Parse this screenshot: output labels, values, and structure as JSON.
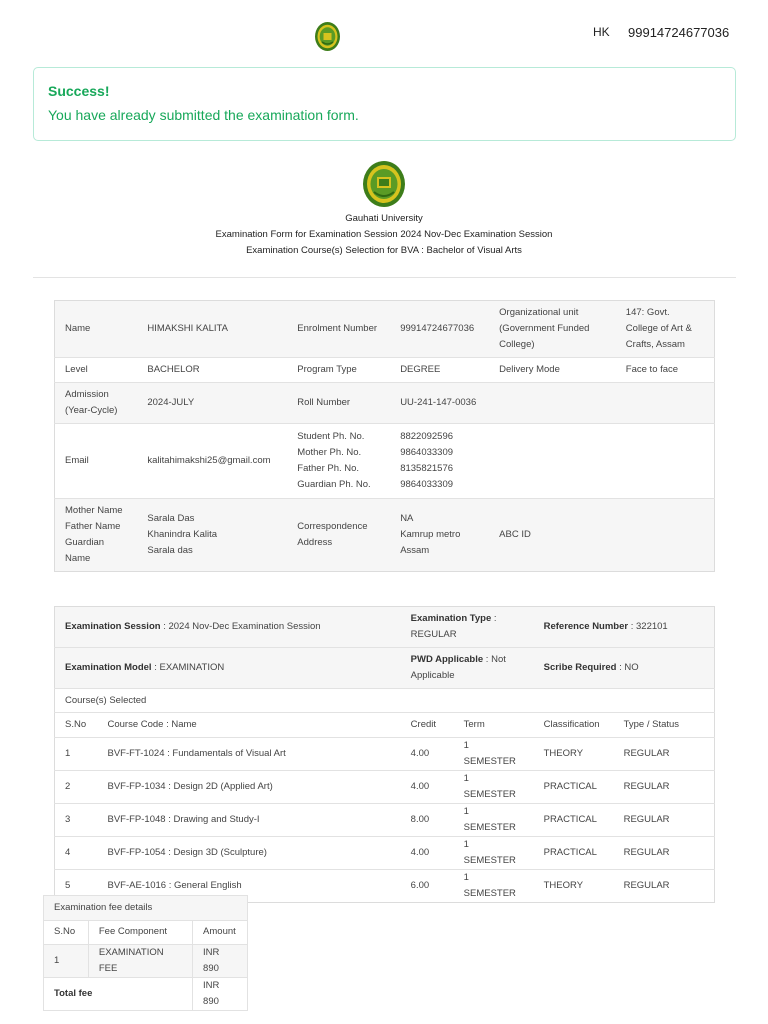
{
  "topbar": {
    "user_initials": "HK",
    "user_id": "99914724677036"
  },
  "alert": {
    "title": "Success!",
    "message": "You have already submitted the examination form."
  },
  "header": {
    "university": "Gauhati University",
    "form_title": "Examination Form for Examination Session 2024 Nov-Dec Examination Session",
    "course_selection": "Examination Course(s) Selection for BVA : Bachelor of Visual Arts"
  },
  "student": {
    "name_label": "Name",
    "name": "HIMAKSHI KALITA",
    "enrolment_label": "Enrolment Number",
    "enrolment": "99914724677036",
    "org_unit_label": "Organizational unit (Government Funded College)",
    "org_unit": "147: Govt. College of Art & Crafts, Assam",
    "level_label": "Level",
    "level": "BACHELOR",
    "program_type_label": "Program Type",
    "program_type": "DEGREE",
    "delivery_mode_label": "Delivery Mode",
    "delivery_mode": "Face to face",
    "admission_label": "Admission (Year-Cycle)",
    "admission": "2024-JULY",
    "roll_label": "Roll Number",
    "roll": "UU-241-147-0036",
    "email_label": "Email",
    "email": "kalitahimakshi25@gmail.com",
    "phone_labels": [
      "Student Ph. No.",
      "Mother Ph. No.",
      "Father Ph. No.",
      "Guardian Ph. No."
    ],
    "phones": [
      "8822092596",
      "9864033309",
      "8135821576",
      "9864033309"
    ],
    "parent_labels": [
      "Mother Name",
      "Father Name",
      "Guardian Name"
    ],
    "parents": [
      "Sarala Das",
      "Khanindra Kalita",
      "Sarala das"
    ],
    "correspondence_label": "Correspondence Address",
    "address_lines": [
      "NA",
      "Kamrup metro",
      "Assam"
    ],
    "abc_label": "ABC ID",
    "abc": ""
  },
  "exam": {
    "session_label": "Examination Session",
    "session": "2024 Nov-Dec Examination Session",
    "type_label": "Examination Type",
    "type": "REGULAR",
    "reference_label": "Reference Number",
    "reference": "322101",
    "model_label": "Examination Model",
    "model": "EXAMINATION",
    "pwd_label": "PWD Applicable",
    "pwd": "Not Applicable",
    "scribe_label": "Scribe Required",
    "scribe": "NO",
    "courses_caption": "Course(s) Selected",
    "course_headers": [
      "S.No",
      "Course Code : Name",
      "Credit",
      "Term",
      "Classification",
      "Type / Status"
    ],
    "courses": [
      [
        "1",
        "BVF-FT-1024 : Fundamentals of Visual Art",
        "4.00",
        "1 SEMESTER",
        "THEORY",
        "REGULAR"
      ],
      [
        "2",
        "BVF-FP-1034 : Design 2D (Applied Art)",
        "4.00",
        "1 SEMESTER",
        "PRACTICAL",
        "REGULAR"
      ],
      [
        "3",
        "BVF-FP-1048 : Drawing and Study-I",
        "8.00",
        "1 SEMESTER",
        "PRACTICAL",
        "REGULAR"
      ],
      [
        "4",
        "BVF-FP-1054 : Design 3D (Sculpture)",
        "4.00",
        "1 SEMESTER",
        "PRACTICAL",
        "REGULAR"
      ],
      [
        "5",
        "BVF-AE-1016 : General English",
        "6.00",
        "1 SEMESTER",
        "THEORY",
        "REGULAR"
      ]
    ]
  },
  "fees": {
    "caption": "Examination fee details",
    "headers": [
      "S.No",
      "Fee Component",
      "Amount"
    ],
    "rows": [
      [
        "1",
        "EXAMINATION FEE",
        "INR 890"
      ]
    ],
    "total_label": "Total fee",
    "total": "INR 890"
  },
  "colors": {
    "success": "#18a85a",
    "alert_border": "#b7ead8",
    "logo_green": "#4a8f1f",
    "logo_yellow": "#d9c21b"
  }
}
